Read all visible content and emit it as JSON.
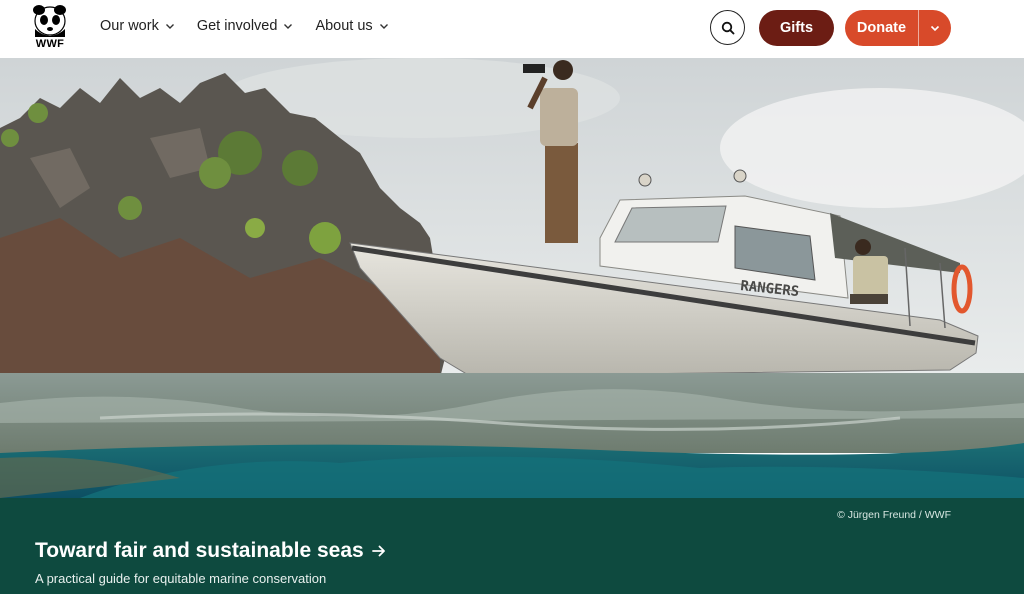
{
  "brand": {
    "logo_text": "WWF"
  },
  "nav": {
    "items": [
      {
        "label": "Our work"
      },
      {
        "label": "Get involved"
      },
      {
        "label": "About us"
      }
    ]
  },
  "actions": {
    "gifts_label": "Gifts",
    "donate_label": "Donate"
  },
  "hero": {
    "boat_text": "RANGERS",
    "photo_credit": "© Jürgen Freund / WWF"
  },
  "feature": {
    "title": "Toward fair and sustainable seas",
    "subtitle": "A practical guide for equitable marine conservation"
  },
  "colors": {
    "gifts": "#6c1d14",
    "donate": "#d84a2a",
    "band": "#0e4a3f"
  },
  "icons": [
    "panda-logo-icon",
    "chevron-down-icon",
    "search-icon",
    "arrow-right-icon"
  ]
}
